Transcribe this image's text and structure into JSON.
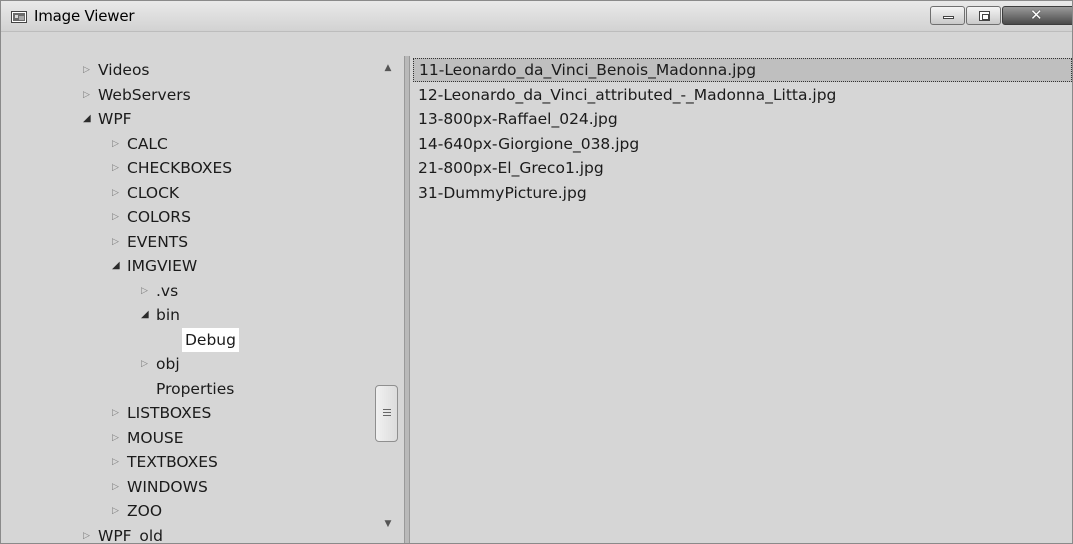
{
  "window": {
    "title": "Image Viewer",
    "controls": {
      "minimize": "minimize",
      "maximize": "maximize",
      "close": "close"
    }
  },
  "tree": {
    "items": [
      {
        "label": "Videos",
        "expander": "collapsed"
      },
      {
        "label": "WebServers",
        "expander": "collapsed"
      },
      {
        "label": "WPF",
        "expander": "expanded"
      },
      {
        "label": "CALC",
        "expander": "collapsed"
      },
      {
        "label": "CHECKBOXES",
        "expander": "collapsed"
      },
      {
        "label": "CLOCK",
        "expander": "collapsed"
      },
      {
        "label": "COLORS",
        "expander": "collapsed"
      },
      {
        "label": "EVENTS",
        "expander": "collapsed"
      },
      {
        "label": "IMGVIEW",
        "expander": "expanded"
      },
      {
        "label": ".vs",
        "expander": "collapsed"
      },
      {
        "label": "bin",
        "expander": "expanded"
      },
      {
        "label": "Debug",
        "expander": "none",
        "selected": true
      },
      {
        "label": "obj",
        "expander": "collapsed"
      },
      {
        "label": "Properties",
        "expander": "none"
      },
      {
        "label": "LISTBOXES",
        "expander": "collapsed"
      },
      {
        "label": "MOUSE",
        "expander": "collapsed"
      },
      {
        "label": "TEXTBOXES",
        "expander": "collapsed"
      },
      {
        "label": "WINDOWS",
        "expander": "collapsed"
      },
      {
        "label": "ZOO",
        "expander": "collapsed"
      },
      {
        "label": "WPF_old",
        "expander": "collapsed"
      }
    ]
  },
  "files": {
    "items": [
      {
        "name": "11-Leonardo_da_Vinci_Benois_Madonna.jpg",
        "selected": true
      },
      {
        "name": "12-Leonardo_da_Vinci_attributed_-_Madonna_Litta.jpg"
      },
      {
        "name": "13-800px-Raffael_024.jpg"
      },
      {
        "name": "14-640px-Giorgione_038.jpg"
      },
      {
        "name": "21-800px-El_Greco1.jpg"
      },
      {
        "name": "31-DummyPicture.jpg"
      }
    ]
  },
  "icons": {
    "app": "image-viewer-icon",
    "collapsed": "tree-collapsed-triangle-icon",
    "expanded": "tree-expanded-triangle-icon"
  }
}
